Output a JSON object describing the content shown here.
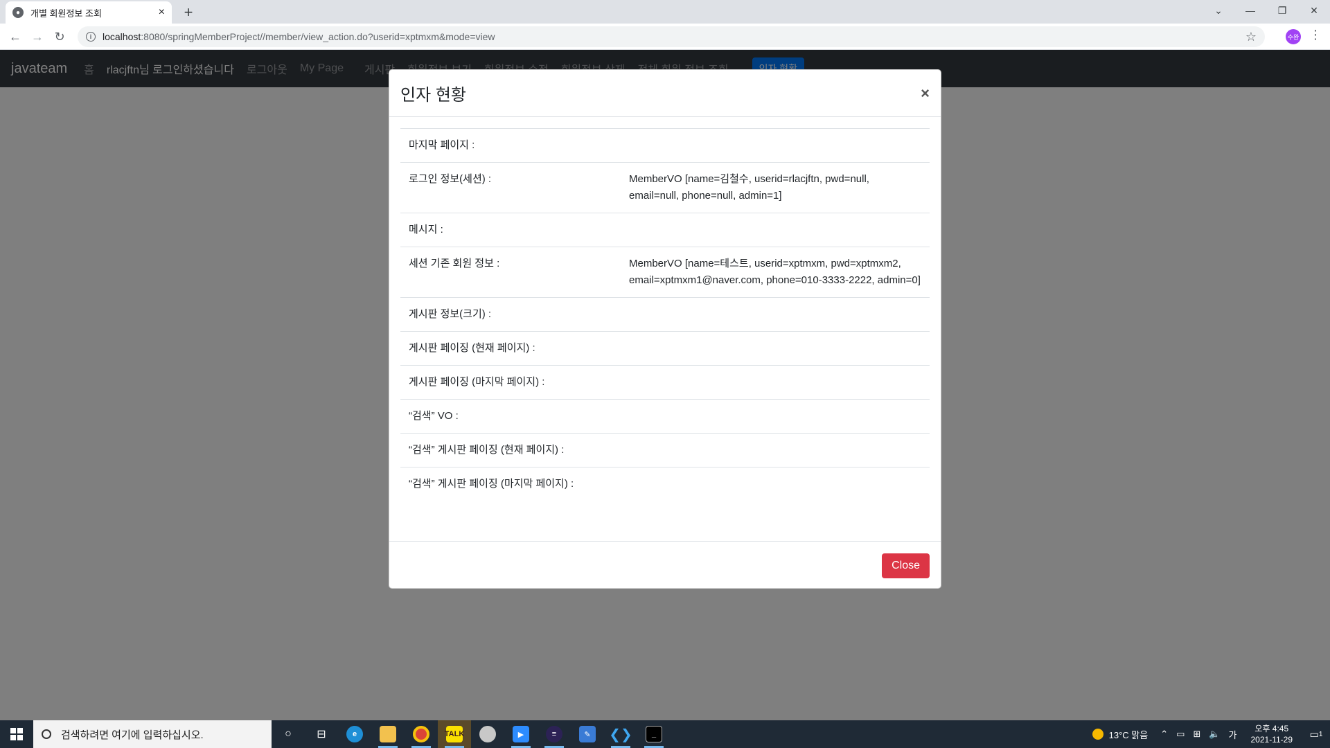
{
  "browser": {
    "tab_title": "개별 회원정보 조회",
    "url_host": "localhost",
    "url_path": ":8080/springMemberProject//member/view_action.do?userid=xptmxm&mode=view",
    "profile_initials": "수완"
  },
  "navbar": {
    "brand": "javateam",
    "links": [
      "홈",
      "rlacjftn님 로그인하셨습니다",
      "로그아웃",
      "My Page",
      "게시판",
      "회원정보 보기",
      "회원정보 수정",
      "회원정보 삭제",
      "전체 회원 정보 조회"
    ],
    "button": "인자 현황"
  },
  "modal": {
    "title": "인자 현황",
    "close_x": "×",
    "rows": [
      {
        "key": "마지막 페이지 :",
        "value": ""
      },
      {
        "key": "로그인 정보(세션) :",
        "value": "MemberVO [name=김철수, userid=rlacjftn, pwd=null, email=null, phone=null, admin=1]"
      },
      {
        "key": "메시지 :",
        "value": ""
      },
      {
        "key": "세션 기존 회원 정보 :",
        "value": "MemberVO [name=테스트, userid=xptmxm, pwd=xptmxm2, email=xptmxm1@naver.com, phone=010-3333-2222, admin=0]"
      },
      {
        "key": "게시판 정보(크기) :",
        "value": ""
      },
      {
        "key": "게시판 페이징 (현재 페이지) :",
        "value": ""
      },
      {
        "key": "게시판 페이징 (마지막 페이지) :",
        "value": ""
      },
      {
        "key": "“검색” VO :",
        "value": ""
      },
      {
        "key": "“검색” 게시판 페이징 (현재 페이지) :",
        "value": ""
      },
      {
        "key": "“검색” 게시판 페이징 (마지막 페이지) :",
        "value": ""
      }
    ],
    "close_button": "Close"
  },
  "taskbar": {
    "search_placeholder": "검색하려면 여기에 입력하십시오.",
    "weather": "13°C  맑음",
    "ime": "가",
    "time": "오후 4:45",
    "date": "2021-11-29",
    "notification_count": "1"
  },
  "colors": {
    "navbar_bg": "#343a40",
    "primary": "#007bff",
    "danger": "#dc3545"
  }
}
